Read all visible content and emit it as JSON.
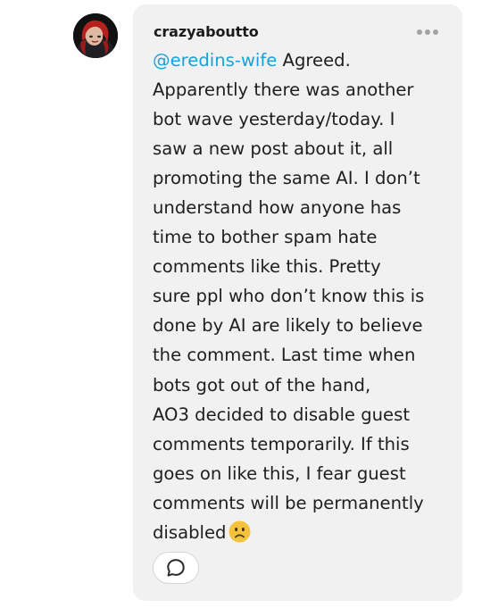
{
  "comment": {
    "username": "crazyaboutto",
    "mention": "@eredins-wife",
    "lines": [
      " Agreed.",
      "Apparently there was another",
      "bot wave yesterday/today. I",
      "saw a new post about it, all",
      "promoting the same AI. I don’t",
      "understand how anyone has",
      "time to bother spam hate",
      "comments like this. Pretty",
      "sure ppl who don’t know this is",
      "done by AI are likely to believe",
      "the comment. Last time when",
      "bots got out of the hand,",
      "AO3 decided to disable guest",
      "comments temporarily. If this",
      "goes on like this, I fear guest",
      "comments will be permanently",
      "disabled"
    ],
    "emoji": "sad-face",
    "avatar_icon": "avatar-red-haired-figure",
    "more_icon": "more-options-icon",
    "reply_icon": "reply-speech-bubble-icon"
  },
  "colors": {
    "bubble_bg": "#f1f1f1",
    "mention": "#1aa0d8",
    "text": "#1e1e1e",
    "emoji": "#f5c33b"
  }
}
